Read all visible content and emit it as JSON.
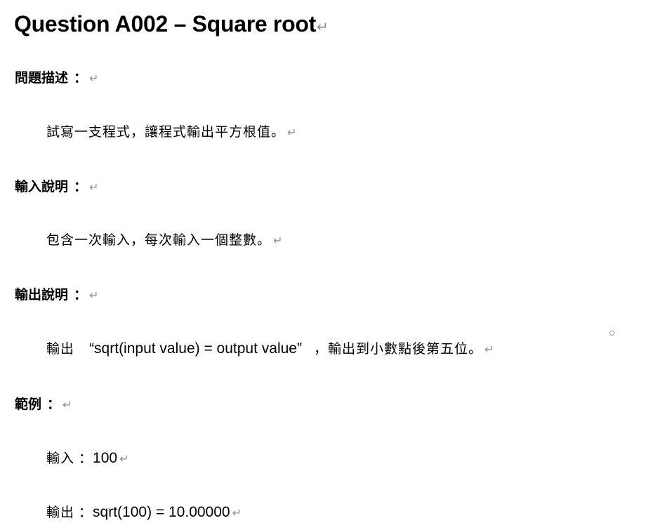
{
  "title": "Question A002 – Square root",
  "sections": [
    {
      "heading": "問題描述",
      "colon": "：",
      "body": "試寫一支程式，讓程式輸出平方根值。"
    },
    {
      "heading": "輸入說明",
      "colon": "：",
      "body": "包含一次輸入，每次輸入一個整數。"
    },
    {
      "heading": "輸出說明",
      "colon": "：",
      "body_prefix": "輸出",
      "body_quote": "“sqrt(input value) = output value”",
      "body_suffix": "，輸出到小數點後第五位。"
    },
    {
      "heading": "範例",
      "colon": "：",
      "input_label": "輸入",
      "input_colon": "：",
      "input_value": "100",
      "output_label": "輸出",
      "output_colon": "：",
      "output_value": "sqrt(100) = 10.00000"
    }
  ],
  "paragraph_mark": "↵",
  "icons": {
    "paragraph_mark": "return-arrow-icon",
    "small_circle": "small-circle-icon"
  },
  "colors": {
    "text": "#000000",
    "formatting_mark": "#8c8c8c"
  }
}
